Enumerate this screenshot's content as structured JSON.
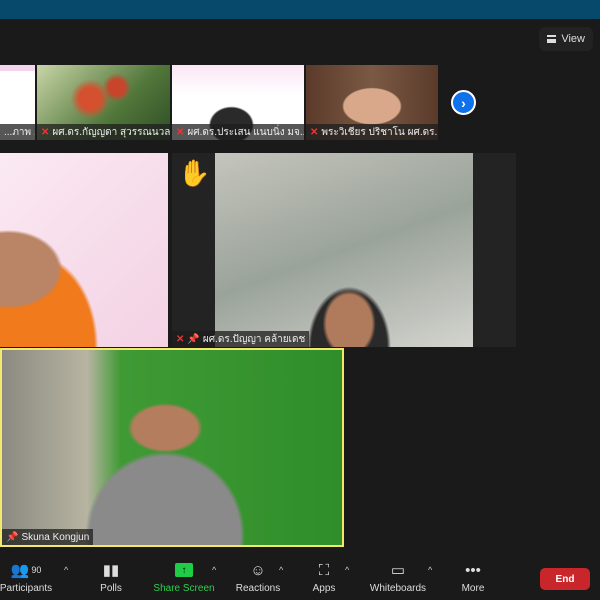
{
  "header": {
    "view_label": "View"
  },
  "thumbnails": [
    {
      "name": "...ภาพ ..."
    },
    {
      "name": "ผศ.ดร.กัญญดา สุวรรณนวล"
    },
    {
      "name": "ผศ.ดร.ประเสน แนบนิ่ง มจ..."
    },
    {
      "name": "พระวิเชียร ปริชาโน ผศ.ดร."
    }
  ],
  "main_tiles": [
    {
      "name": ""
    },
    {
      "name": "ผศ.ดร.ปัญญา คล้ายเดช",
      "hand_raised": true
    }
  ],
  "active_speaker": {
    "name": "Skuna Kongjun",
    "border_color": "#f2e96b"
  },
  "toolbar": {
    "participants_label": "Participants",
    "participants_count": "90",
    "polls_label": "Polls",
    "share_label": "Share Screen",
    "reactions_label": "Reactions",
    "apps_label": "Apps",
    "whiteboards_label": "Whiteboards",
    "more_label": "More",
    "end_label": "End",
    "share_color": "#1fcc45",
    "end_color": "#c9262b"
  }
}
